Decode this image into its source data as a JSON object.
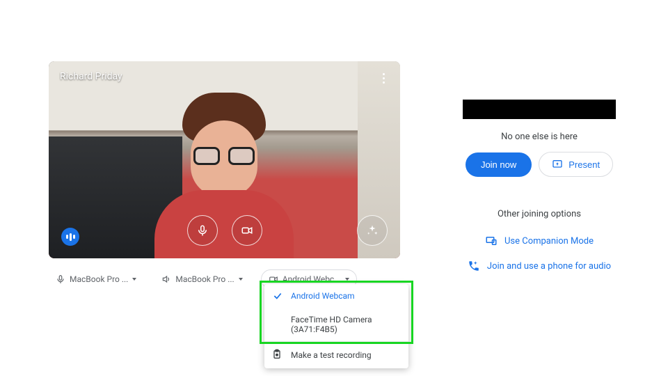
{
  "preview": {
    "participant_name": "Richard Priday"
  },
  "devices": {
    "mic": {
      "label": "MacBook Pro ..."
    },
    "speaker": {
      "label": "MacBook Pro ..."
    },
    "camera": {
      "selected_label": "Android Webc...",
      "options": [
        {
          "label": "Android Webcam",
          "selected": true
        },
        {
          "label": "FaceTime HD Camera (3A71:F4B5)",
          "selected": false
        }
      ],
      "action_label": "Make a test recording"
    }
  },
  "join_panel": {
    "status": "No one else is here",
    "join_label": "Join now",
    "present_label": "Present",
    "other_heading": "Other joining options",
    "companion_label": "Use Companion Mode",
    "phone_audio_label": "Join and use a phone for audio"
  }
}
